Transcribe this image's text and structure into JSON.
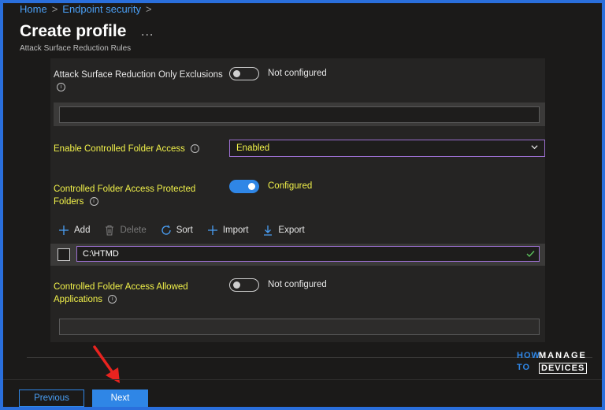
{
  "breadcrumb": {
    "items": [
      "Home",
      "Endpoint security"
    ],
    "separator": ">"
  },
  "header": {
    "title": "Create profile",
    "more": "...",
    "subtitle": "Attack Surface Reduction Rules"
  },
  "settings": {
    "asr_exclusions": {
      "label": "Attack Surface Reduction Only Exclusions",
      "toggle_state": "Not configured",
      "toggle_on": false,
      "input_value": ""
    },
    "cfa": {
      "label": "Enable Controlled Folder Access",
      "value": "Enabled"
    },
    "protected_folders": {
      "label_line1": "Controlled Folder Access Protected",
      "label_line2": "Folders",
      "toggle_state": "Configured",
      "toggle_on": true
    },
    "allowed_apps": {
      "label_line1": "Controlled Folder Access Allowed",
      "label_line2": "Applications",
      "toggle_state": "Not configured",
      "toggle_on": false,
      "input_value": ""
    }
  },
  "toolbar": {
    "add": "Add",
    "delete": "Delete",
    "sort": "Sort",
    "import": "Import",
    "export": "Export"
  },
  "folder_rows": [
    {
      "value": "C:\\HTMD"
    }
  ],
  "logo": {
    "how": "HOW",
    "to": "TO",
    "manage": "MANAGE",
    "devices": "DEVICES"
  },
  "footer": {
    "previous": "Previous",
    "next": "Next"
  },
  "colors": {
    "accent": "#2f86e6",
    "highlight": "#f2f24a",
    "focus_border": "#9b6fcf",
    "annotation_arrow": "#e8231f"
  }
}
